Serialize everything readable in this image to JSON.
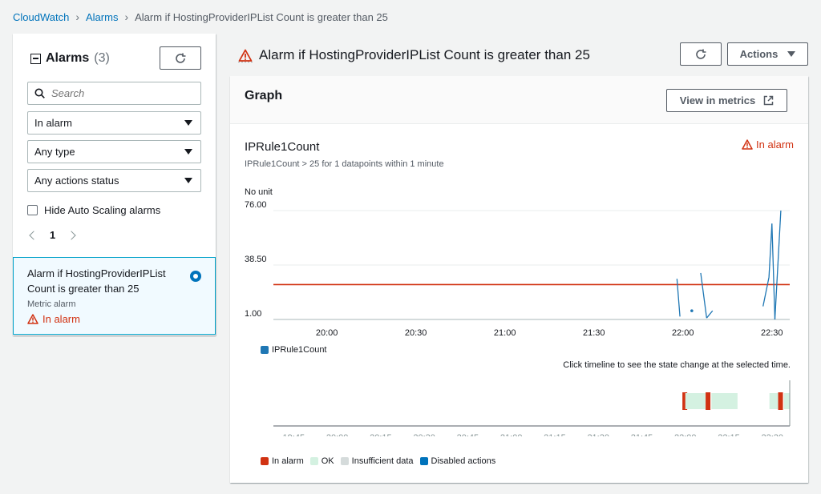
{
  "breadcrumb": {
    "root": "CloudWatch",
    "alarms": "Alarms",
    "current": "Alarm if HostingProviderIPList Count is greater than 25"
  },
  "left_panel": {
    "title": "Alarms",
    "count": "(3)",
    "search_placeholder": "Search",
    "filter_state": "In alarm",
    "filter_type": "Any type",
    "filter_actions": "Any actions status",
    "hide_autoscaling": "Hide Auto Scaling alarms",
    "page": "1",
    "alarm": {
      "name": "Alarm if HostingProviderIPList Count is greater than 25",
      "type": "Metric alarm",
      "state": "In alarm"
    }
  },
  "main": {
    "title": "Alarm if HostingProviderIPList Count is greater than 25",
    "actions_label": "Actions",
    "graph_heading": "Graph",
    "view_in_metrics": "View in metrics",
    "metric_title": "IPRule1Count",
    "metric_desc": "IPRule1Count > 25 for 1 datapoints within 1 minute",
    "state": "In alarm",
    "unit": "No unit",
    "timeline_hint": "Click timeline to see the state change at the selected time."
  },
  "colors": {
    "alarm": "#d13212",
    "ok": "#d4f1e1",
    "insufficient": "#d5dbdb",
    "disabled": "#0073bb",
    "series": "#1f77b4"
  },
  "chart_data": {
    "type": "line",
    "title": "IPRule1Count",
    "ylabel": "No unit",
    "y_ticks": [
      "76.00",
      "38.50",
      "1.00"
    ],
    "ylim": [
      1,
      76
    ],
    "x_ticks": [
      "20:00",
      "20:30",
      "21:00",
      "21:30",
      "22:00",
      "22:30"
    ],
    "threshold": 25,
    "series": [
      {
        "name": "IPRule1Count",
        "points": [
          {
            "t": "21:58",
            "v": 29
          },
          {
            "t": "21:59",
            "v": 3
          },
          {
            "t": "22:03",
            "v": 7
          },
          {
            "t": "22:06",
            "v": 33
          },
          {
            "t": "22:08",
            "v": 2
          },
          {
            "t": "22:10",
            "v": 7
          },
          {
            "t": "22:27",
            "v": 10
          },
          {
            "t": "22:29",
            "v": 30
          },
          {
            "t": "22:30",
            "v": 67
          },
          {
            "t": "22:31",
            "v": 1
          },
          {
            "t": "22:33",
            "v": 76
          }
        ]
      }
    ],
    "timeline": {
      "x_ticks": [
        "19:45",
        "20:00",
        "20:15",
        "20:30",
        "20:45",
        "21:00",
        "21:15",
        "21:30",
        "21:45",
        "22:00",
        "22:15",
        "22:30"
      ],
      "legend": [
        "In alarm",
        "OK",
        "Insufficient data",
        "Disabled actions"
      ],
      "segments": [
        {
          "start": "21:59",
          "end": "22:00",
          "state": "In alarm"
        },
        {
          "start": "22:00",
          "end": "22:07",
          "state": "OK"
        },
        {
          "start": "22:07",
          "end": "22:09",
          "state": "In alarm"
        },
        {
          "start": "22:09",
          "end": "22:18",
          "state": "OK"
        },
        {
          "start": "22:29",
          "end": "22:32",
          "state": "OK"
        },
        {
          "start": "22:32",
          "end": "22:34",
          "state": "In alarm"
        },
        {
          "start": "22:34",
          "end": "22:36",
          "state": "OK"
        }
      ]
    }
  }
}
